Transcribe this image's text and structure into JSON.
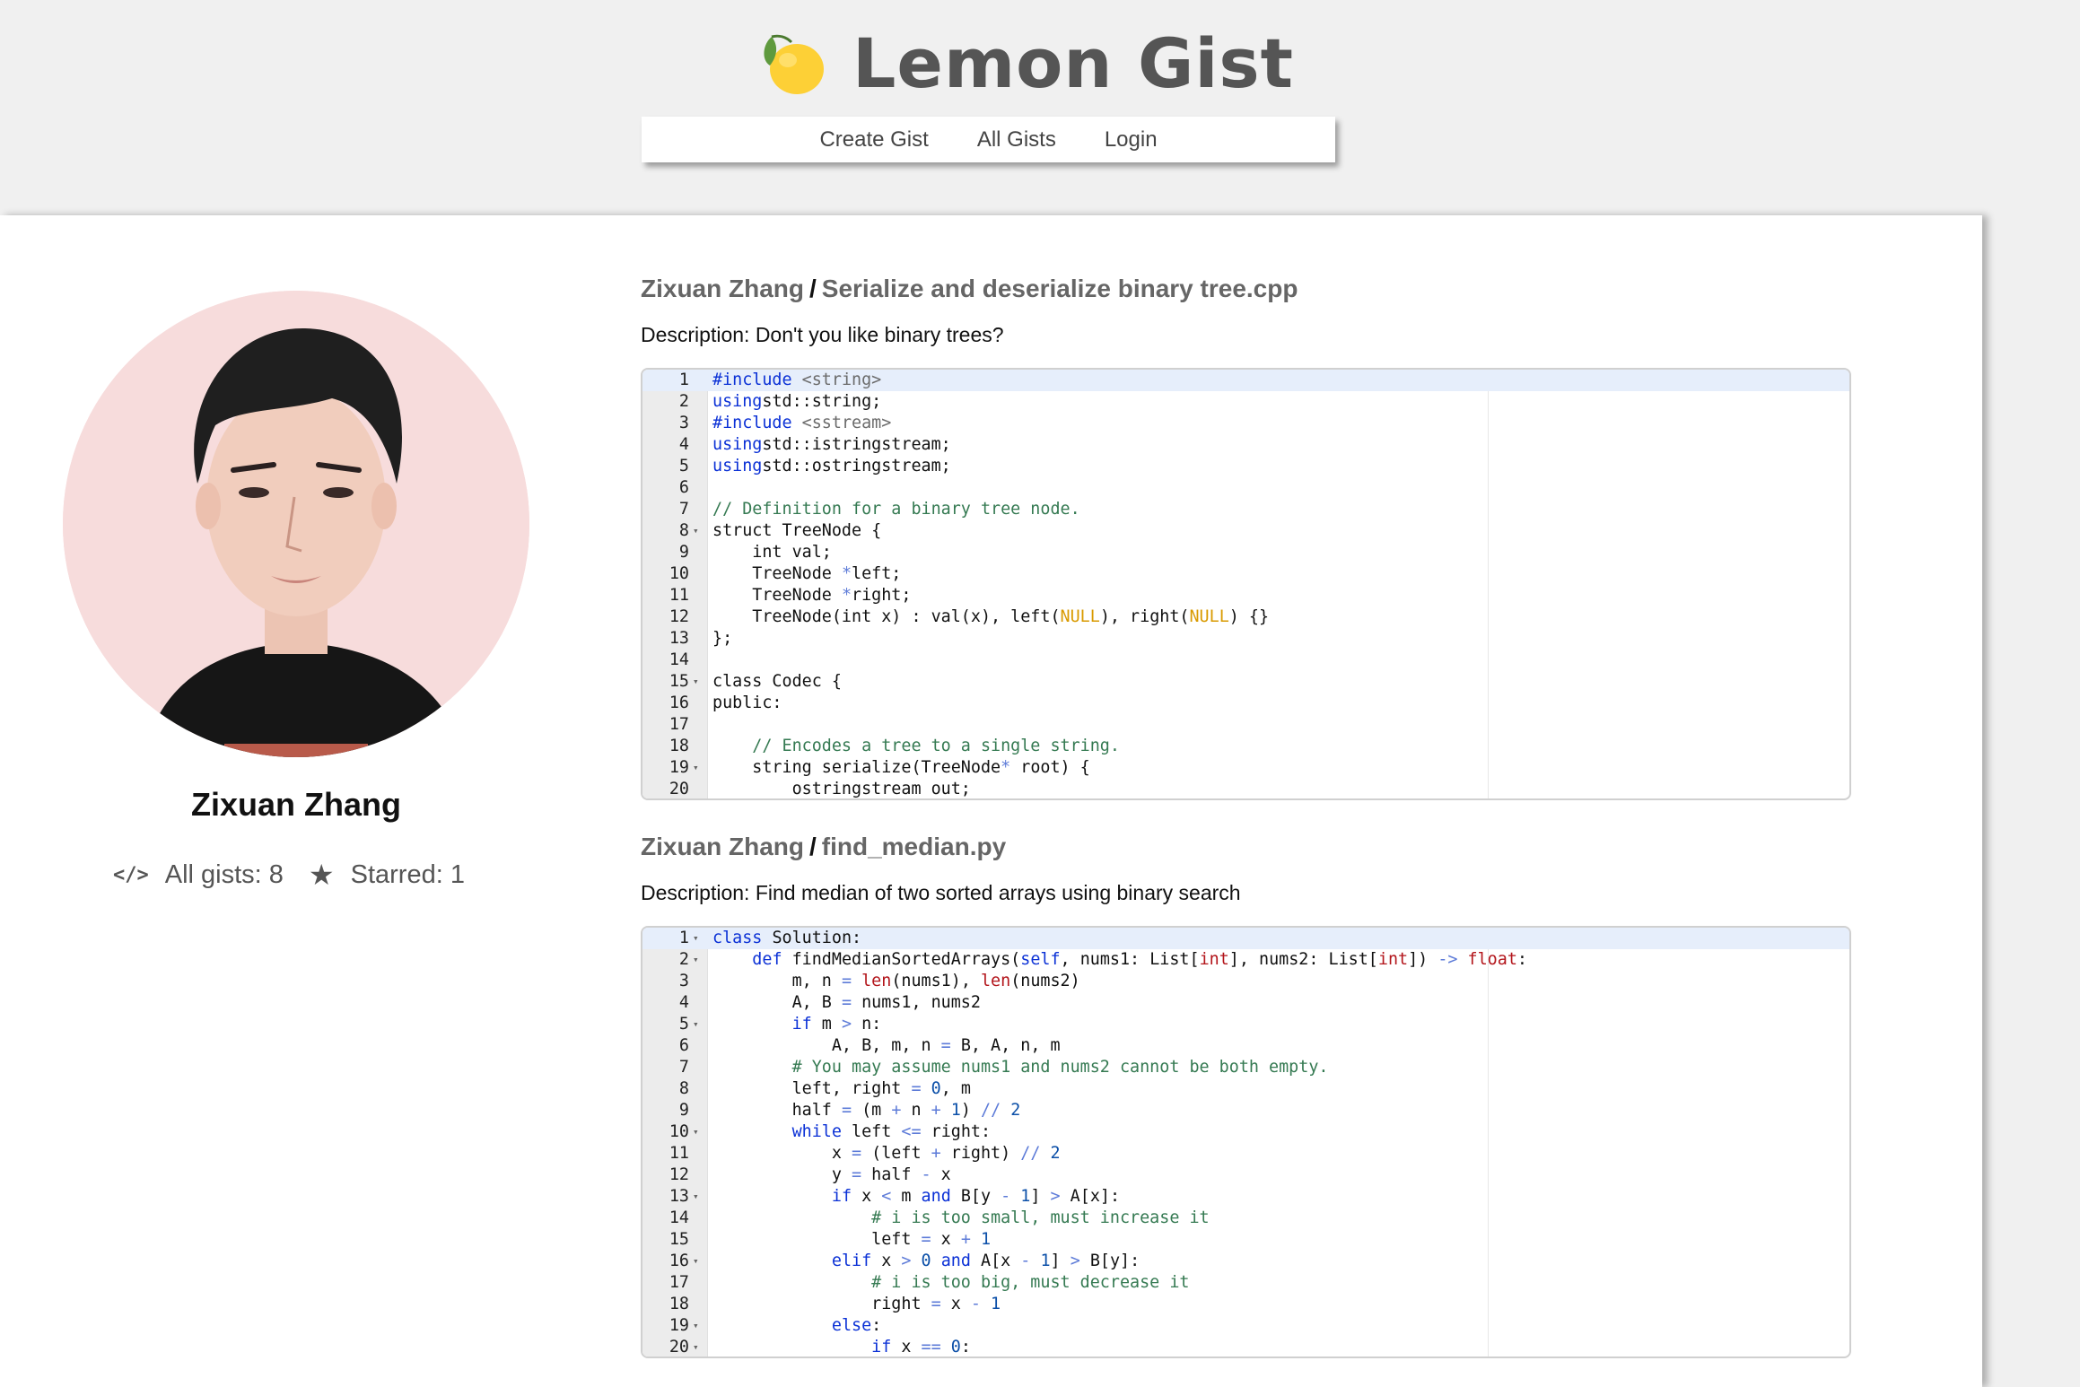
{
  "app": {
    "title": "Lemon Gist",
    "logo_icon": "lemon-icon"
  },
  "nav": {
    "create_label": "Create Gist",
    "all_label": "All Gists",
    "login_label": "Login"
  },
  "profile": {
    "name": "Zixuan Zhang",
    "all_gists_label": "All gists: 8",
    "starred_label": "Starred: 1",
    "code_icon": "</>",
    "star_icon": "★"
  },
  "gists": [
    {
      "author": "Zixuan Zhang",
      "filename": "Serialize and deserialize binary tree.cpp",
      "description": "Description: Don't you like binary trees?",
      "lines": [
        {
          "n": "1",
          "fold": false,
          "tokens": [
            [
              "kw",
              "#include"
            ],
            [
              "str",
              " <string>"
            ]
          ]
        },
        {
          "n": "2",
          "fold": false,
          "tokens": [
            [
              "kw",
              "using"
            ],
            [
              "",
              "std::string;"
            ]
          ]
        },
        {
          "n": "3",
          "fold": false,
          "tokens": [
            [
              "kw",
              "#include"
            ],
            [
              "str",
              " <sstream>"
            ]
          ]
        },
        {
          "n": "4",
          "fold": false,
          "tokens": [
            [
              "kw",
              "using"
            ],
            [
              "",
              "std::istringstream;"
            ]
          ]
        },
        {
          "n": "5",
          "fold": false,
          "tokens": [
            [
              "kw",
              "using"
            ],
            [
              "",
              "std::ostringstream;"
            ]
          ]
        },
        {
          "n": "6",
          "fold": false,
          "tokens": []
        },
        {
          "n": "7",
          "fold": false,
          "tokens": [
            [
              "cm",
              "// Definition for a binary tree node."
            ]
          ]
        },
        {
          "n": "8",
          "fold": true,
          "tokens": [
            [
              "",
              "struct TreeNode {"
            ]
          ]
        },
        {
          "n": "9",
          "fold": false,
          "tokens": [
            [
              "",
              "    int val;"
            ]
          ]
        },
        {
          "n": "10",
          "fold": false,
          "tokens": [
            [
              "",
              "    TreeNode "
            ],
            [
              "op",
              "*"
            ],
            [
              "",
              "left;"
            ]
          ]
        },
        {
          "n": "11",
          "fold": false,
          "tokens": [
            [
              "",
              "    TreeNode "
            ],
            [
              "op",
              "*"
            ],
            [
              "",
              "right;"
            ]
          ]
        },
        {
          "n": "12",
          "fold": false,
          "tokens": [
            [
              "",
              "    TreeNode(int x) : val(x), left("
            ],
            [
              "nl",
              "NULL"
            ],
            [
              "",
              "), right("
            ],
            [
              "nl",
              "NULL"
            ],
            [
              "",
              ") {}"
            ]
          ]
        },
        {
          "n": "13",
          "fold": false,
          "tokens": [
            [
              "",
              "};"
            ]
          ]
        },
        {
          "n": "14",
          "fold": false,
          "tokens": []
        },
        {
          "n": "15",
          "fold": true,
          "tokens": [
            [
              "",
              "class Codec {"
            ]
          ]
        },
        {
          "n": "16",
          "fold": false,
          "tokens": [
            [
              "",
              "public:"
            ]
          ]
        },
        {
          "n": "17",
          "fold": false,
          "tokens": []
        },
        {
          "n": "18",
          "fold": false,
          "tokens": [
            [
              "cm",
              "    // Encodes a tree to a single string."
            ]
          ]
        },
        {
          "n": "19",
          "fold": true,
          "tokens": [
            [
              "",
              "    string serialize(TreeNode"
            ],
            [
              "op",
              "*"
            ],
            [
              "",
              " root) {"
            ]
          ]
        },
        {
          "n": "20",
          "fold": false,
          "tokens": [
            [
              "",
              "        ostringstream out;"
            ]
          ]
        }
      ]
    },
    {
      "author": "Zixuan Zhang",
      "filename": "find_median.py",
      "description": "Description: Find median of two sorted arrays using binary search",
      "lines": [
        {
          "n": "1",
          "fold": true,
          "tokens": [
            [
              "kw",
              "class"
            ],
            [
              "",
              " Solution:"
            ]
          ]
        },
        {
          "n": "2",
          "fold": true,
          "tokens": [
            [
              "",
              "    "
            ],
            [
              "kw",
              "def"
            ],
            [
              "",
              " findMedianSortedArrays("
            ],
            [
              "kw",
              "self"
            ],
            [
              "",
              ", nums1: List["
            ],
            [
              "ty",
              "int"
            ],
            [
              "",
              "], nums2: List["
            ],
            [
              "ty",
              "int"
            ],
            [
              "",
              "]) "
            ],
            [
              "op",
              "->"
            ],
            [
              "",
              ""
            ],
            [
              "ty",
              " float"
            ],
            [
              "",
              ":"
            ]
          ]
        },
        {
          "n": "3",
          "fold": false,
          "tokens": [
            [
              "",
              "        m, n "
            ],
            [
              "op",
              "="
            ],
            [
              "",
              ""
            ],
            [
              "bi",
              " len"
            ],
            [
              "",
              "(nums1), "
            ],
            [
              "bi",
              "len"
            ],
            [
              "",
              "(nums2)"
            ]
          ]
        },
        {
          "n": "4",
          "fold": false,
          "tokens": [
            [
              "",
              "        A, B "
            ],
            [
              "op",
              "="
            ],
            [
              "",
              " nums1, nums2"
            ]
          ]
        },
        {
          "n": "5",
          "fold": true,
          "tokens": [
            [
              "",
              "        "
            ],
            [
              "kw",
              "if"
            ],
            [
              "",
              " m "
            ],
            [
              "op",
              ">"
            ],
            [
              "",
              " n:"
            ]
          ]
        },
        {
          "n": "6",
          "fold": false,
          "tokens": [
            [
              "",
              "            A, B, m, n "
            ],
            [
              "op",
              "="
            ],
            [
              "",
              " B, A, n, m"
            ]
          ]
        },
        {
          "n": "7",
          "fold": false,
          "tokens": [
            [
              "cm",
              "        # You may assume nums1 and nums2 cannot be both empty."
            ]
          ]
        },
        {
          "n": "8",
          "fold": false,
          "tokens": [
            [
              "",
              "        left, right "
            ],
            [
              "op",
              "="
            ],
            [
              "",
              " "
            ],
            [
              "num",
              "0"
            ],
            [
              "",
              ", m"
            ]
          ]
        },
        {
          "n": "9",
          "fold": false,
          "tokens": [
            [
              "",
              "        half "
            ],
            [
              "op",
              "="
            ],
            [
              "",
              " (m "
            ],
            [
              "op",
              "+"
            ],
            [
              "",
              " n "
            ],
            [
              "op",
              "+"
            ],
            [
              "",
              " "
            ],
            [
              "num",
              "1"
            ],
            [
              "",
              ") "
            ],
            [
              "op",
              "//"
            ],
            [
              "",
              " "
            ],
            [
              "num",
              "2"
            ]
          ]
        },
        {
          "n": "10",
          "fold": true,
          "tokens": [
            [
              "",
              "        "
            ],
            [
              "kw",
              "while"
            ],
            [
              "",
              " left "
            ],
            [
              "op",
              "<="
            ],
            [
              "",
              " right:"
            ]
          ]
        },
        {
          "n": "11",
          "fold": false,
          "tokens": [
            [
              "",
              "            x "
            ],
            [
              "op",
              "="
            ],
            [
              "",
              " (left "
            ],
            [
              "op",
              "+"
            ],
            [
              "",
              " right) "
            ],
            [
              "op",
              "//"
            ],
            [
              "",
              " "
            ],
            [
              "num",
              "2"
            ]
          ]
        },
        {
          "n": "12",
          "fold": false,
          "tokens": [
            [
              "",
              "            y "
            ],
            [
              "op",
              "="
            ],
            [
              "",
              " half "
            ],
            [
              "op",
              "-"
            ],
            [
              "",
              " x"
            ]
          ]
        },
        {
          "n": "13",
          "fold": true,
          "tokens": [
            [
              "",
              "            "
            ],
            [
              "kw",
              "if"
            ],
            [
              "",
              " x "
            ],
            [
              "op",
              "<"
            ],
            [
              "",
              " m "
            ],
            [
              "kw",
              "and"
            ],
            [
              "",
              " B[y "
            ],
            [
              "op",
              "-"
            ],
            [
              "",
              " "
            ],
            [
              "num",
              "1"
            ],
            [
              "",
              "] "
            ],
            [
              "op",
              ">"
            ],
            [
              "",
              " A[x]:"
            ]
          ]
        },
        {
          "n": "14",
          "fold": false,
          "tokens": [
            [
              "cm",
              "                # i is too small, must increase it"
            ]
          ]
        },
        {
          "n": "15",
          "fold": false,
          "tokens": [
            [
              "",
              "                left "
            ],
            [
              "op",
              "="
            ],
            [
              "",
              " x "
            ],
            [
              "op",
              "+"
            ],
            [
              "",
              " "
            ],
            [
              "num",
              "1"
            ]
          ]
        },
        {
          "n": "16",
          "fold": true,
          "tokens": [
            [
              "",
              "            "
            ],
            [
              "kw",
              "elif"
            ],
            [
              "",
              " x "
            ],
            [
              "op",
              ">"
            ],
            [
              "",
              " "
            ],
            [
              "num",
              "0"
            ],
            [
              "",
              " "
            ],
            [
              "kw",
              "and"
            ],
            [
              "",
              " A[x "
            ],
            [
              "op",
              "-"
            ],
            [
              "",
              " "
            ],
            [
              "num",
              "1"
            ],
            [
              "",
              "] "
            ],
            [
              "op",
              ">"
            ],
            [
              "",
              " B[y]:"
            ]
          ]
        },
        {
          "n": "17",
          "fold": false,
          "tokens": [
            [
              "cm",
              "                # i is too big, must decrease it"
            ]
          ]
        },
        {
          "n": "18",
          "fold": false,
          "tokens": [
            [
              "",
              "                right "
            ],
            [
              "op",
              "="
            ],
            [
              "",
              " x "
            ],
            [
              "op",
              "-"
            ],
            [
              "",
              " "
            ],
            [
              "num",
              "1"
            ]
          ]
        },
        {
          "n": "19",
          "fold": true,
          "tokens": [
            [
              "",
              "            "
            ],
            [
              "kw",
              "else"
            ],
            [
              "",
              ":"
            ]
          ]
        },
        {
          "n": "20",
          "fold": true,
          "tokens": [
            [
              "",
              "                "
            ],
            [
              "kw",
              "if"
            ],
            [
              "",
              " x "
            ],
            [
              "op",
              "=="
            ],
            [
              "",
              " "
            ],
            [
              "num",
              "0"
            ],
            [
              "",
              ":"
            ]
          ]
        }
      ]
    }
  ]
}
